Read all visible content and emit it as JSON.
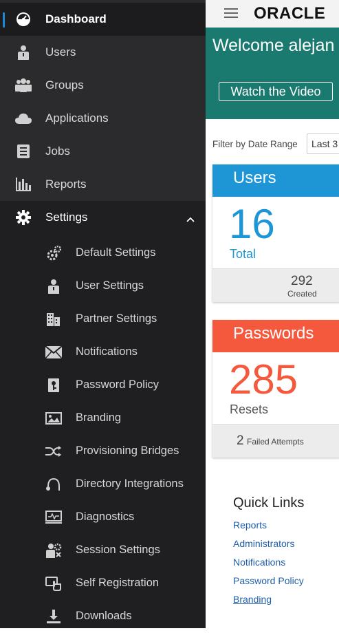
{
  "sidebar": {
    "items": [
      {
        "label": "Dashboard",
        "icon": "dashboard-gauge-icon",
        "active": true
      },
      {
        "label": "Users",
        "icon": "user-icon"
      },
      {
        "label": "Groups",
        "icon": "group-icon"
      },
      {
        "label": "Applications",
        "icon": "cloud-icon"
      },
      {
        "label": "Jobs",
        "icon": "jobs-list-icon"
      },
      {
        "label": "Reports",
        "icon": "bar-chart-icon"
      },
      {
        "label": "Settings",
        "icon": "gear-icon",
        "expanded": true
      }
    ],
    "settings_sub": [
      {
        "label": "Default Settings",
        "icon": "gears-icon"
      },
      {
        "label": "User Settings",
        "icon": "user-settings-icon"
      },
      {
        "label": "Partner Settings",
        "icon": "building-icon"
      },
      {
        "label": "Notifications",
        "icon": "envelope-icon"
      },
      {
        "label": "Password Policy",
        "icon": "password-policy-icon"
      },
      {
        "label": "Branding",
        "icon": "image-icon"
      },
      {
        "label": "Provisioning Bridges",
        "icon": "shuffle-icon"
      },
      {
        "label": "Directory Integrations",
        "icon": "directory-icon"
      },
      {
        "label": "Diagnostics",
        "icon": "monitor-pulse-icon"
      },
      {
        "label": "Session Settings",
        "icon": "user-gear-icon"
      },
      {
        "label": "Self Registration",
        "icon": "self-registration-icon"
      },
      {
        "label": "Downloads",
        "icon": "download-icon"
      }
    ]
  },
  "topbar": {
    "brand": "ORACLE",
    "menu_icon": "hamburger-icon"
  },
  "hero": {
    "title": "Welcome alejan",
    "button": "Watch the Video",
    "bg_color": "#1a7a70"
  },
  "filter": {
    "label": "Filter by Date Range",
    "value": "Last 3"
  },
  "users_card": {
    "title": "Users",
    "count": "16",
    "count_label": "Total",
    "footer_value": "292",
    "footer_label": "Created",
    "color": "#1e96d6"
  },
  "passwords_card": {
    "title": "Passwords",
    "count": "285",
    "count_label": "Resets",
    "footer_value": "2",
    "footer_label": "Failed Attempts",
    "color": "#f5593d"
  },
  "quick_links": {
    "title": "Quick Links",
    "links": [
      "Reports",
      "Administrators",
      "Notifications",
      "Password Policy",
      "Branding"
    ]
  }
}
